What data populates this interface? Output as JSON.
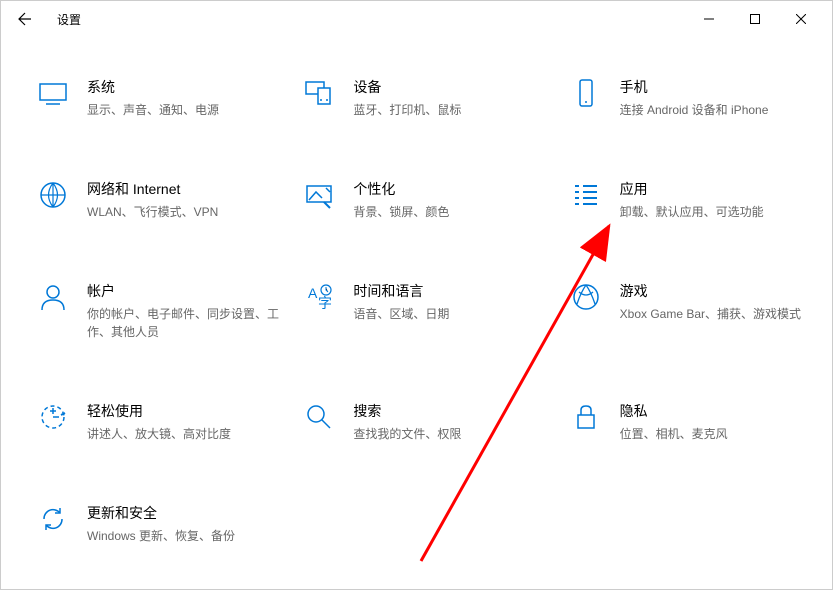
{
  "window": {
    "title": "设置"
  },
  "tiles": [
    {
      "title": "系统",
      "desc": "显示、声音、通知、电源"
    },
    {
      "title": "设备",
      "desc": "蓝牙、打印机、鼠标"
    },
    {
      "title": "手机",
      "desc": "连接 Android 设备和 iPhone"
    },
    {
      "title": "网络和 Internet",
      "desc": "WLAN、飞行模式、VPN"
    },
    {
      "title": "个性化",
      "desc": "背景、锁屏、颜色"
    },
    {
      "title": "应用",
      "desc": "卸载、默认应用、可选功能"
    },
    {
      "title": "帐户",
      "desc": "你的帐户、电子邮件、同步设置、工作、其他人员"
    },
    {
      "title": "时间和语言",
      "desc": "语音、区域、日期"
    },
    {
      "title": "游戏",
      "desc": "Xbox Game Bar、捕获、游戏模式"
    },
    {
      "title": "轻松使用",
      "desc": "讲述人、放大镜、高对比度"
    },
    {
      "title": "搜索",
      "desc": "查找我的文件、权限"
    },
    {
      "title": "隐私",
      "desc": "位置、相机、麦克风"
    },
    {
      "title": "更新和安全",
      "desc": "Windows 更新、恢复、备份"
    }
  ]
}
